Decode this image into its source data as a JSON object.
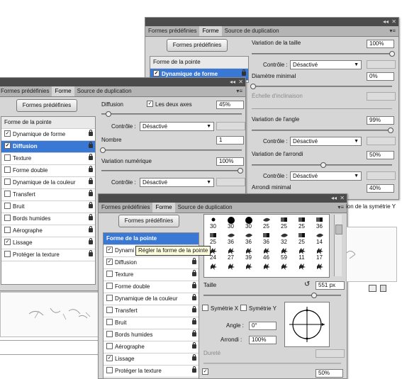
{
  "tabs": {
    "preset": "Formes prédéfinies",
    "brush": "Forme",
    "clone": "Source de duplication"
  },
  "preset_button": "Formes prédéfinies",
  "list": {
    "tip_shape": "Forme de la pointe",
    "shape_dynamics": "Dynamique de forme",
    "scattering": "Diffusion",
    "texture": "Texture",
    "dual_brush": "Forme double",
    "color_dynamics": "Dynamique de la couleur",
    "transfer": "Transfert",
    "noise": "Bruit",
    "wet_edges": "Bords humides",
    "airbrush": "Aérographe",
    "smoothing": "Lissage",
    "protect_texture": "Protéger la texture"
  },
  "back": {
    "size_jitter": "Variation de la taille",
    "size_jitter_value": "100%",
    "control": "Contrôle :",
    "control_value": "Désactivé",
    "min_diameter": "Diamètre minimal",
    "min_diameter_value": "0%",
    "tilt_scale": "Échelle d'inclinaison",
    "angle_jitter": "Variation de l'angle",
    "angle_jitter_value": "99%",
    "roundness_jitter": "Variation de l'arrondi",
    "roundness_jitter_value": "50%",
    "min_roundness": "Arrondi minimal",
    "min_roundness_value": "40%",
    "flip_y_fragment": "ion de la symétrie Y"
  },
  "middle": {
    "scatter": "Diffusion",
    "both_axes": "Les deux axes",
    "scatter_value": "45%",
    "control": "Contrôle :",
    "control_value": "Désactivé",
    "count": "Nombre",
    "count_value": "1",
    "count_jitter": "Variation numérique",
    "count_jitter_value": "100%"
  },
  "front": {
    "tooltip": "Régler la forme de la pointe",
    "shape_dynamics_partial": "Dynami",
    "size_label": "Taille",
    "size_value": "551 px",
    "flip_x": "Symétrie X",
    "flip_y": "Symétrie Y",
    "angle_label": "Angle :",
    "angle_value": "0°",
    "roundness_label": "Arrondi :",
    "roundness_value": "100%",
    "hardness": "Dureté",
    "spacing_partial_value": "50%",
    "tips": [
      {
        "n": "30",
        "shape": "dot-sm"
      },
      {
        "n": "30",
        "shape": "dot-lg"
      },
      {
        "n": "30",
        "shape": "dot-lg"
      },
      {
        "n": "25",
        "shape": "leaf"
      },
      {
        "n": "25",
        "shape": "rect"
      },
      {
        "n": "25",
        "shape": "rect"
      },
      {
        "n": "36",
        "shape": "rect"
      },
      {
        "n": "25",
        "shape": "rect"
      },
      {
        "n": "36",
        "shape": "leaf"
      },
      {
        "n": "36",
        "shape": "leaf"
      },
      {
        "n": "36",
        "shape": "rect"
      },
      {
        "n": "32",
        "shape": "leaf"
      },
      {
        "n": "25",
        "shape": "rect"
      },
      {
        "n": "14",
        "shape": "leaf"
      },
      {
        "n": "24",
        "shape": "splat"
      },
      {
        "n": "27",
        "shape": "splat"
      },
      {
        "n": "39",
        "shape": "splat"
      },
      {
        "n": "46",
        "shape": "splat"
      },
      {
        "n": "59",
        "shape": "splat"
      },
      {
        "n": "11",
        "shape": "splat"
      },
      {
        "n": "17",
        "shape": "splat"
      },
      {
        "n": "",
        "shape": "splat"
      },
      {
        "n": "",
        "shape": "splat"
      },
      {
        "n": "",
        "shape": "splat"
      },
      {
        "n": "",
        "shape": "splat"
      },
      {
        "n": "",
        "shape": "splat"
      },
      {
        "n": "",
        "shape": "splat"
      },
      {
        "n": "",
        "shape": "splat"
      }
    ]
  },
  "colors": {
    "selection": "#3a78d6",
    "panel": "#d6d6d6",
    "titlebar": "#4b4b4b"
  }
}
